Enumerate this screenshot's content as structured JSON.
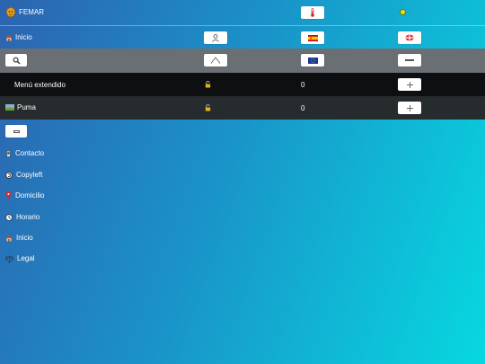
{
  "header": {
    "brand": "FEMAR"
  },
  "table": {
    "inicio_label": "Inicio",
    "menu_label": "Menú extendido",
    "menu_count": "0",
    "puma_label": "Puma",
    "puma_count": "0"
  },
  "icons": {
    "brand": "lion-logo-icon",
    "thermometer": "thermometer-icon",
    "status": "yellow-status-dot-icon",
    "home": "home-icon",
    "user": "user-icon",
    "flag_es": "spain-flag-icon",
    "flag_other": "round-flag-icon",
    "search": "search-icon",
    "triangle": "triangle-icon",
    "flag_eu": "eu-flag-icon",
    "minus": "minus-icon",
    "plus": "plus-icon",
    "lock": "lock-icon",
    "puma_img": "puma-thumbnail-icon",
    "collapse": "collapse-icon"
  },
  "nav": {
    "items": [
      {
        "label": "Contacto",
        "icon": "phone-icon"
      },
      {
        "label": "Copyleft",
        "icon": "copyleft-icon"
      },
      {
        "label": "Domicilio",
        "icon": "location-pin-icon"
      },
      {
        "label": "Horario",
        "icon": "clock-icon"
      },
      {
        "label": "Inicio",
        "icon": "home-icon"
      },
      {
        "label": "Legal",
        "icon": "scales-icon"
      }
    ]
  },
  "colors": {
    "gradient_start": "#2d63b0",
    "gradient_end": "#07d8e0",
    "search_row": "#6a6f74",
    "menu_row": "#0d0f10",
    "puma_row": "#262b2e",
    "status_dot": "#e8e020"
  }
}
